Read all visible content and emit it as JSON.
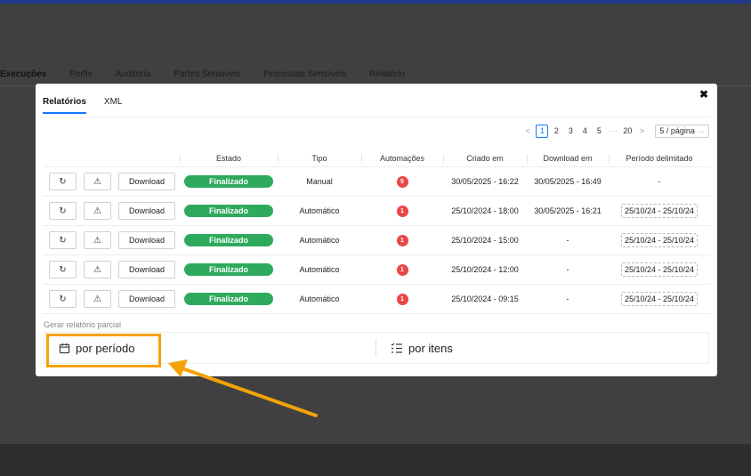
{
  "background": {
    "tabs": [
      {
        "label": "Execuções",
        "active": true
      },
      {
        "label": "Perfis",
        "active": false
      },
      {
        "label": "Auditoria",
        "active": false
      },
      {
        "label": "Partes Sensíveis",
        "active": false
      },
      {
        "label": "Processos Sensíveis",
        "active": false
      },
      {
        "label": "Relatório",
        "active": false
      }
    ]
  },
  "modal": {
    "close_symbol": "✖",
    "tabs": [
      {
        "label": "Relatórios",
        "active": true
      },
      {
        "label": "XML",
        "active": false
      }
    ],
    "pagination": {
      "prev": "<",
      "next": ">",
      "pages": [
        "1",
        "2",
        "3",
        "4",
        "5"
      ],
      "current": "1",
      "ellipsis": "···",
      "last": "20",
      "page_size": "5 / página"
    },
    "table": {
      "columns": [
        "Estado",
        "Tipo",
        "Automações",
        "Criado em",
        "Download em",
        "Período delimitado"
      ],
      "download_label": "Download",
      "rows": [
        {
          "estado": "Finalizado",
          "tipo": "Manual",
          "automacoes": "5",
          "criado": "30/05/2025 - 16:22",
          "download": "30/05/2025 - 16:49",
          "periodo": "-",
          "periodo_tag": false
        },
        {
          "estado": "Finalizado",
          "tipo": "Automático",
          "automacoes": "1",
          "criado": "25/10/2024 - 18:00",
          "download": "30/05/2025 - 16:21",
          "periodo": "25/10/24 - 25/10/24",
          "periodo_tag": true
        },
        {
          "estado": "Finalizado",
          "tipo": "Automático",
          "automacoes": "1",
          "criado": "25/10/2024 - 15:00",
          "download": "-",
          "periodo": "25/10/24 - 25/10/24",
          "periodo_tag": true
        },
        {
          "estado": "Finalizado",
          "tipo": "Automático",
          "automacoes": "1",
          "criado": "25/10/2024 - 12:00",
          "download": "-",
          "periodo": "25/10/24 - 25/10/24",
          "periodo_tag": true
        },
        {
          "estado": "Finalizado",
          "tipo": "Automático",
          "automacoes": "1",
          "criado": "25/10/2024 - 09:15",
          "download": "-",
          "periodo": "25/10/24 - 25/10/24",
          "periodo_tag": true
        }
      ]
    },
    "partial": {
      "label": "Gerar relatório parcial",
      "by_period": "por período",
      "by_items": "por itens"
    }
  },
  "icons": {
    "reload": "reload-icon",
    "warning": "warning-icon",
    "calendar": "calendar-icon",
    "list": "list-icon"
  },
  "colors": {
    "accent": "#1677ff",
    "success": "#2eaa5c",
    "danger": "#e94848",
    "highlight": "#f5a20a"
  }
}
